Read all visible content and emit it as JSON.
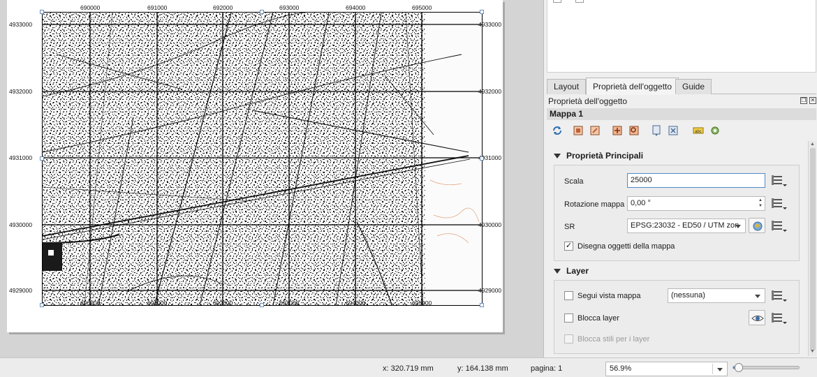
{
  "map": {
    "top_labels": [
      "690000",
      "691000",
      "692000",
      "693000",
      "694000",
      "695000"
    ],
    "bottom_labels": [
      "690000",
      "691000",
      "692000",
      "693000",
      "694000",
      "695000"
    ],
    "left_labels": [
      "4933000",
      "4932000",
      "4931000",
      "4930000",
      "4929000"
    ],
    "right_labels": [
      "4933000",
      "4932000",
      "4931000",
      "4930000",
      "4929000"
    ]
  },
  "tabs": [
    {
      "label": "Layout"
    },
    {
      "label": "Proprietà dell'oggetto"
    },
    {
      "label": "Guide"
    }
  ],
  "panel": {
    "title": "Proprietà dell'oggetto",
    "item_name": "Mappa 1"
  },
  "main_props": {
    "title": "Proprietà Principali",
    "scale_label": "Scala",
    "scale_value": "25000",
    "rotation_label": "Rotazione mappa",
    "rotation_value": "0,00 °",
    "crs_label": "SR",
    "crs_value": "EPSG:23032 - ED50 / UTM zon",
    "draw_items_label": "Disegna oggetti della mappa",
    "draw_items_checked": true
  },
  "layer_props": {
    "title": "Layer",
    "follow_label": "Segui vista mappa",
    "follow_value": "(nessuna)",
    "lock_label": "Blocca layer",
    "lock_styles_label": "Blocca stili per i layer"
  },
  "status": {
    "x": "x: 320.719 mm",
    "y": "y: 164.138 mm",
    "page": "pagina: 1",
    "zoom": "56.9%",
    "zoom_fraction": 0.09
  },
  "icons": [
    "refresh-icon",
    "export-icon",
    "zoom-icon",
    "data-defined-icon",
    "map-theme-icon",
    "label-icon",
    "settings-icon"
  ],
  "colors": {
    "accent": "#4f89cc",
    "panel_bg": "#efefef"
  }
}
